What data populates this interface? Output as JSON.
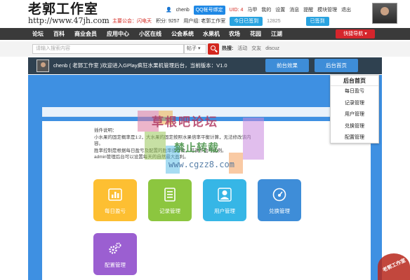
{
  "logo": {
    "title": "老郭工作室",
    "url": "http://www.47jh.com"
  },
  "topbar": {
    "user": "chenb",
    "qq_bind": "QQ帐号绑定",
    "uid": "UID: 4",
    "links": [
      "马甲",
      "我的",
      "设置",
      "消息",
      "提醒",
      "模块管理",
      "退出"
    ],
    "notice_label": "主要公会：闪电天",
    "points": "积分: 9257",
    "group": "用户组: 老郭工作室",
    "sign_today": "今日已签到",
    "count": "12825",
    "signed": "已签到"
  },
  "nav": {
    "items": [
      "论坛",
      "百科",
      "商业会员",
      "应用中心",
      "小区在线",
      "公会系统",
      "水果机",
      "农场",
      "花园",
      "江湖"
    ],
    "quick": "快捷导航"
  },
  "search": {
    "placeholder": "请输入搜索内容",
    "type": "帖子",
    "hot_label": "热搜:",
    "hot_terms": [
      "活动",
      "交友",
      "discuz"
    ]
  },
  "admin": {
    "welcome": "chenb ( 老郭工作室 )欢迎进入GPlay疯狂水果机管理后台，当前版本：V1.0",
    "front_btn": "前台效果",
    "back_btn": "后台首页"
  },
  "dropdown": {
    "title": "后台首页",
    "items": [
      "每日盈亏",
      "记录管理",
      "用户管理",
      "兑换管理",
      "配置管理"
    ]
  },
  "description": {
    "lines": [
      "插件说明：",
      "小水果的固定概率是1:2，大水果的固定按照水果倍率平衡计算，无法修改该内容。",
      "胜率控制是根据每日盈亏及配置的胜率值修改，可调节盈亏比例。",
      "admin管理后台可以设置每天的自然最大盈利。"
    ]
  },
  "tiles": [
    {
      "label": "每日盈亏",
      "color": "#fdbf32",
      "icon": "bar-chart-icon"
    },
    {
      "label": "记录管理",
      "color": "#8cc63f",
      "icon": "list-icon"
    },
    {
      "label": "用户管理",
      "color": "#36b6e6",
      "icon": "user-icon"
    },
    {
      "label": "兑换管理",
      "color": "#3e8dd8",
      "icon": "gauge-icon"
    },
    {
      "label": "配置管理",
      "color": "#9b5fd1",
      "icon": "gears-icon"
    }
  ],
  "watermark": {
    "line1": "草根吧论坛",
    "line2": "禁止转载",
    "line3": "www.cgzz8.com",
    "stamp": "老郭工作室"
  }
}
